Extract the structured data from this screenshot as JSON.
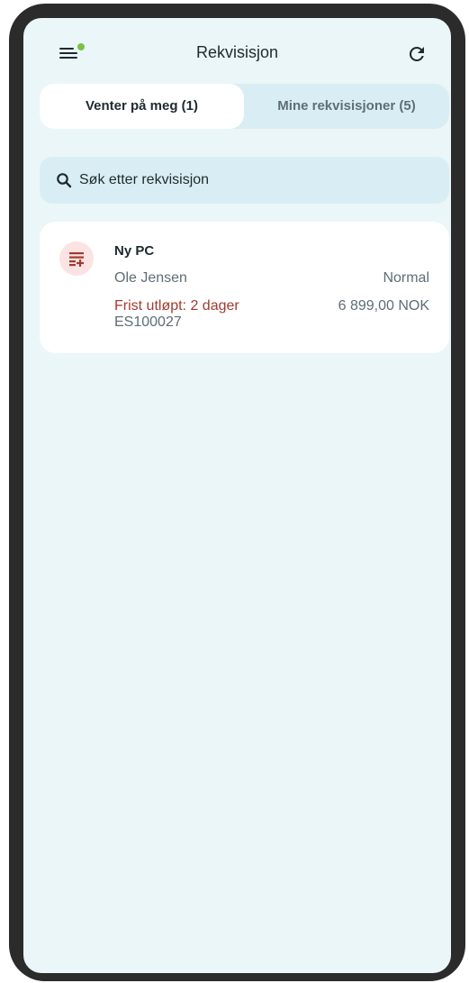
{
  "header": {
    "title": "Rekvisisjon",
    "menu_icon": "menu-icon",
    "refresh_icon": "refresh-icon",
    "notification_dot_color": "#7cc242"
  },
  "tabs": [
    {
      "label": "Venter på meg (1)",
      "active": true
    },
    {
      "label": "Mine rekvisisjoner (5)",
      "active": false
    }
  ],
  "search": {
    "icon": "search-icon",
    "placeholder": "Søk etter rekvisisjon",
    "value": ""
  },
  "requisitions": [
    {
      "icon": "requisition-list-add-icon",
      "title": "Ny PC",
      "requester": "Ole Jensen",
      "priority": "Normal",
      "deadline": "Frist utløpt: 2 dager",
      "amount": "6 899,00 NOK",
      "id": "ES100027"
    }
  ],
  "colors": {
    "background": "#ebf6f9",
    "surface": "#d9eef4",
    "card": "#ffffff",
    "text_primary": "#1f2a2e",
    "text_secondary": "#5e6e74",
    "danger": "#a33a2f",
    "icon_bg": "#fbe3e3"
  }
}
